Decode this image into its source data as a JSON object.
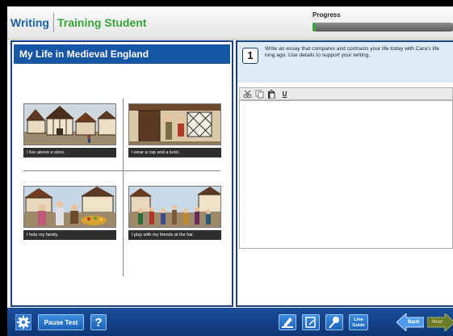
{
  "header": {
    "subject": "Writing",
    "student_name": "Training Student",
    "progress_label": "Progress",
    "progress_fraction": 0.02
  },
  "passage": {
    "title": "My Life in Medieval England",
    "images": [
      {
        "caption": "I live above a store.",
        "icon": "medieval-street-scene"
      },
      {
        "caption": "I wear a cap and a tunic.",
        "icon": "boy-and-girl-at-house"
      },
      {
        "caption": "I help my family.",
        "icon": "market-family-scene"
      },
      {
        "caption": "I play with my friends at the fair.",
        "icon": "fair-crowd-scene"
      }
    ]
  },
  "question": {
    "number": "1",
    "text": "Write an essay that compares and contrasts your life today with Cara's life long ago. Use details to support your writing."
  },
  "editor": {
    "toolbar": [
      "cut-icon",
      "copy-icon",
      "paste-icon",
      "underline-icon"
    ],
    "underline_label": "U",
    "value": ""
  },
  "footer": {
    "pause_label": "Pause Test",
    "help_label": "?",
    "line_guide_label": "Line Guide",
    "back_label": "Back",
    "next_label": "Next"
  },
  "colors": {
    "brand_blue": "#1656a6",
    "accent_green": "#3aa23a",
    "footer_blue": "#0e3576"
  }
}
